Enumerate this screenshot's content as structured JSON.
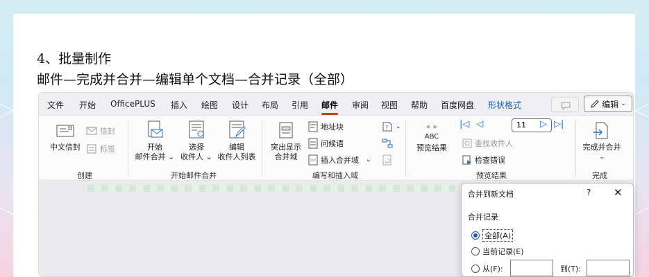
{
  "doc": {
    "heading1": "4、批量制作",
    "heading2": "邮件—完成并合并—编辑单个文档—合并记录（全部）"
  },
  "tabs": [
    {
      "label": "文件"
    },
    {
      "label": "开始"
    },
    {
      "label": "OfficePLUS"
    },
    {
      "label": "插入"
    },
    {
      "label": "绘图"
    },
    {
      "label": "设计"
    },
    {
      "label": "布局"
    },
    {
      "label": "引用"
    },
    {
      "label": "邮件"
    },
    {
      "label": "审阅"
    },
    {
      "label": "视图"
    },
    {
      "label": "帮助"
    },
    {
      "label": "百度网盘"
    },
    {
      "label": "形状格式"
    }
  ],
  "edit_button": {
    "label": "编辑",
    "icon": "pencil-icon"
  },
  "comment_button": {
    "icon": "comment-icon"
  },
  "groups": {
    "create": {
      "label": "创建",
      "chinese_envelope": "中文信封",
      "envelope": "信封",
      "labels": "标签"
    },
    "start_merge": {
      "label": "开始邮件合并",
      "start_merge": [
        "开始",
        "邮件合并"
      ],
      "select_recipients": [
        "选择",
        "收件人"
      ],
      "edit_list": [
        "编辑",
        "收件人列表"
      ]
    },
    "write_insert": {
      "label": "编写和插入域",
      "highlight": [
        "突出显示",
        "合并域"
      ],
      "address_block": "地址块",
      "greeting": "问候语",
      "insert_field": "插入合并域"
    },
    "preview": {
      "label": "预览结果",
      "abc_icon_text": "ABC",
      "preview_results": "预览结果",
      "record_value": "11",
      "find_recipient": "查找收件人",
      "check_errors": "检查错误"
    },
    "finish": {
      "label": "完成",
      "finish_merge": "完成并合并"
    }
  },
  "dialog": {
    "title": "合并到新文档",
    "help": "?",
    "close": "✕",
    "section": "合并记录",
    "options": [
      {
        "label": "全部(A)",
        "checked": true
      },
      {
        "label": "当前记录(E)",
        "checked": false
      },
      {
        "label": "从(F):",
        "checked": false
      }
    ],
    "to_label": "到(T):"
  }
}
